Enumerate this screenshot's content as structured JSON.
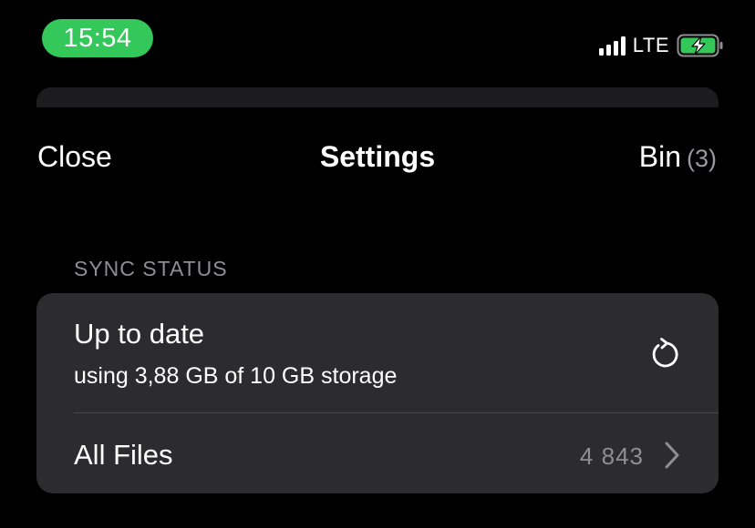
{
  "status_bar": {
    "time": "15:54",
    "network": "LTE",
    "colors": {
      "time_pill": "#34c759",
      "battery_fill": "#34c759"
    },
    "icons": [
      "signal-icon",
      "battery-charging-icon"
    ]
  },
  "nav": {
    "close_label": "Close",
    "title": "Settings",
    "bin_label": "Bin",
    "bin_count": "(3)"
  },
  "sync": {
    "section_header": "SYNC STATUS",
    "status_title": "Up to date",
    "storage_text": "using 3,88 GB of 10 GB storage",
    "refresh_icon": "refresh-icon"
  },
  "files": {
    "label": "All Files",
    "count": "4 843",
    "chevron_icon": "chevron-right-icon"
  }
}
